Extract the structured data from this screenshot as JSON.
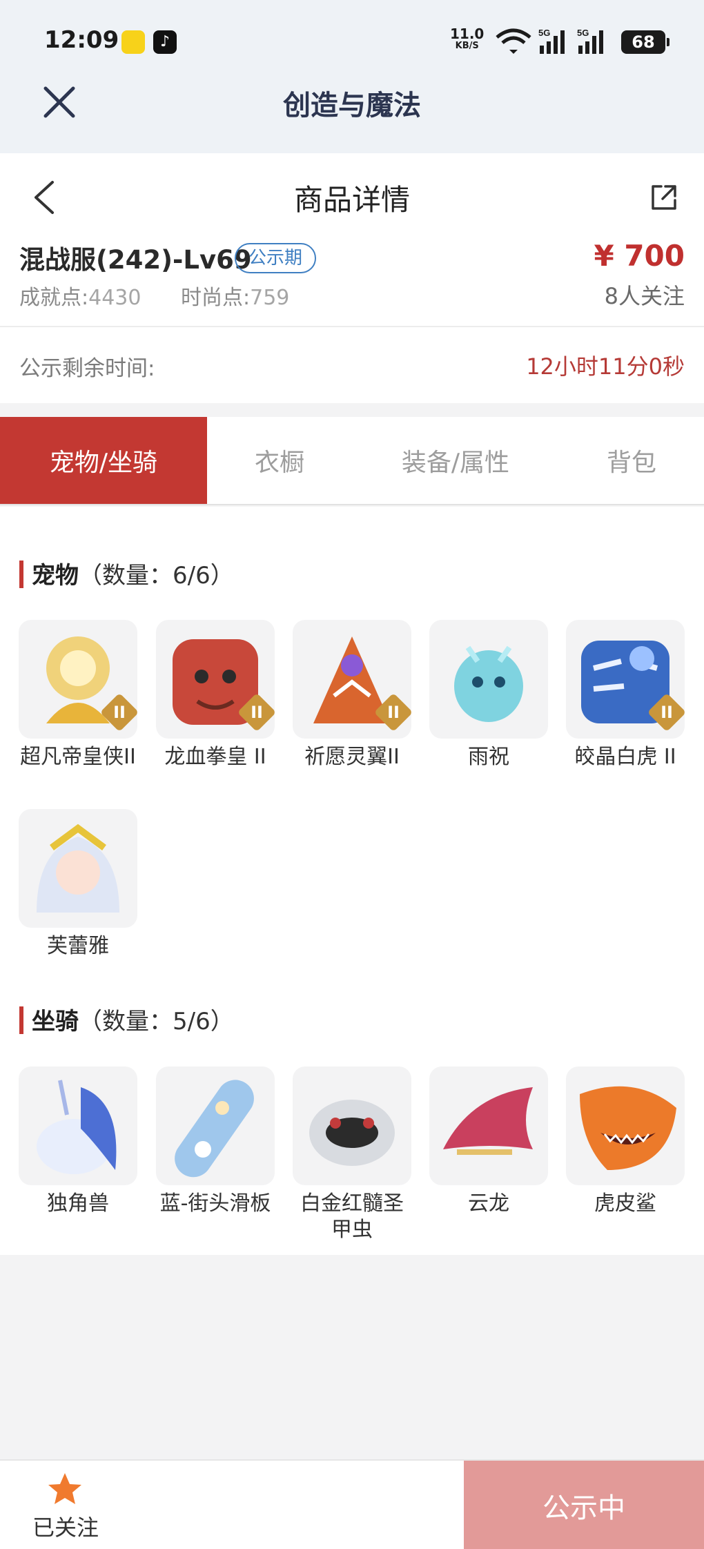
{
  "status_bar": {
    "time": "12:09",
    "speed_value": "11.0",
    "speed_unit": "KB/S",
    "battery": "68"
  },
  "header": {
    "app_title": "创造与魔法"
  },
  "detail": {
    "page_title": "商品详情",
    "item_name": "混战服(242)-Lv69",
    "badge": "公示期",
    "price": "¥ 700",
    "achievement_label": "成就点:",
    "achievement_value": "4430",
    "fashion_label": "时尚点:",
    "fashion_value": "759",
    "followers": "8人关注",
    "remaining_label": "公示剩余时间:",
    "remaining_value": "12小时11分0秒"
  },
  "tabs": [
    {
      "label": "宠物/坐骑",
      "active": true
    },
    {
      "label": "衣橱",
      "active": false
    },
    {
      "label": "装备/属性",
      "active": false
    },
    {
      "label": "背包",
      "active": false
    }
  ],
  "pets": {
    "title": "宠物",
    "count": "（数量：6/6）",
    "items": [
      {
        "name": "超凡帝皇侠II",
        "tier": "II",
        "color": "#e8b43a"
      },
      {
        "name": "龙血拳皇 II",
        "tier": "II",
        "color": "#c8483a"
      },
      {
        "name": "祈愿灵翼II",
        "tier": "II",
        "color": "#d9652e"
      },
      {
        "name": "雨祝",
        "tier": "",
        "color": "#7fd3e0"
      },
      {
        "name": "皎晶白虎 II",
        "tier": "II",
        "color": "#3a6bc4"
      },
      {
        "name": "芙蕾雅",
        "tier": "",
        "color": "#e7c43a"
      }
    ]
  },
  "mounts": {
    "title": "坐骑",
    "count": "（数量：5/6）",
    "items": [
      {
        "name": "独角兽",
        "color": "#4d6fd4"
      },
      {
        "name": "蓝-街头滑板",
        "color": "#9fc7ec"
      },
      {
        "name": "白金红髓圣甲虫",
        "color": "#c33b3b"
      },
      {
        "name": "云龙",
        "color": "#c9405e"
      },
      {
        "name": "虎皮鲨",
        "color": "#ec7a2a"
      }
    ]
  },
  "bottom": {
    "follow_label": "已关注",
    "status_label": "公示中"
  },
  "colors": {
    "accent": "#c33832",
    "price": "#c0302f",
    "badge": "#3f7fc2",
    "status_button": "#e29a98"
  }
}
